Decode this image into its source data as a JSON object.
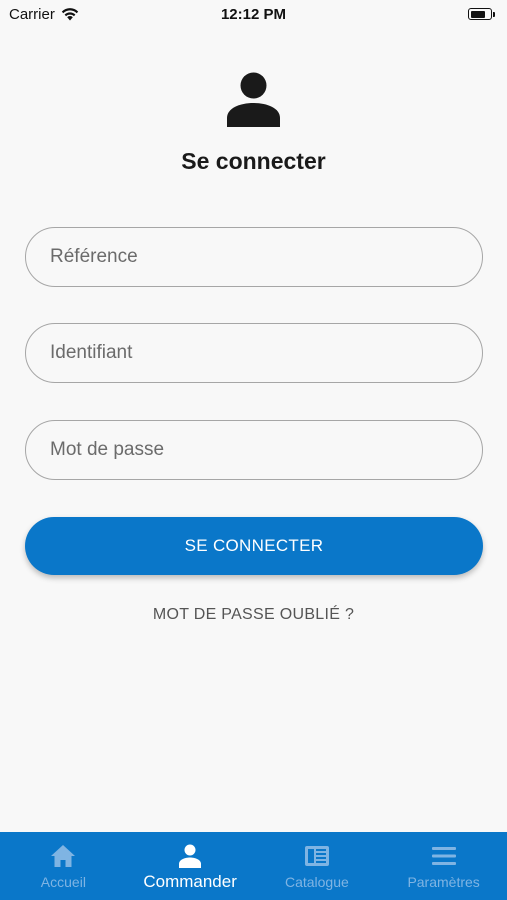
{
  "status_bar": {
    "carrier": "Carrier",
    "time": "12:12 PM",
    "battery_level": 0.75
  },
  "header": {
    "avatar_icon": "person-icon",
    "title": "Se connecter"
  },
  "form": {
    "reference_placeholder": "Référence",
    "identifiant_placeholder": "Identifiant",
    "password_placeholder": "Mot de passe",
    "submit_label": "SE CONNECTER",
    "forgot_label": "MOT DE PASSE OUBLIÉ ?"
  },
  "tab_bar": {
    "items": [
      {
        "label": "Accueil",
        "icon": "home-icon",
        "active": false
      },
      {
        "label": "Commander",
        "icon": "person-icon",
        "active": true
      },
      {
        "label": "Catalogue",
        "icon": "catalog-icon",
        "active": false
      },
      {
        "label": "Paramètres",
        "icon": "menu-icon",
        "active": false
      }
    ]
  },
  "colors": {
    "accent": "#0a77c9",
    "tab_inactive": "#7fb4e3",
    "background": "#f8f8f8"
  }
}
